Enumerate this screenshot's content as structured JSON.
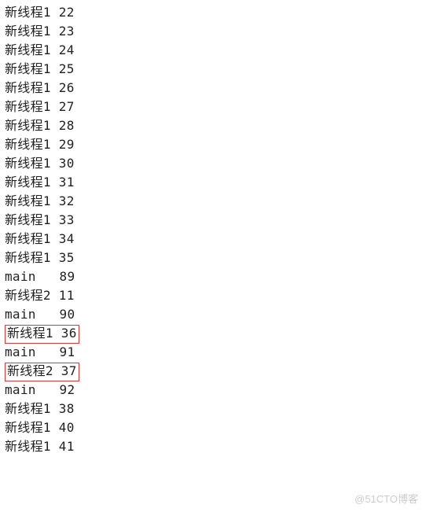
{
  "watermark": "@51CTO博客",
  "lines": [
    {
      "label": "新线程1",
      "value": "22",
      "highlight": false,
      "wide": false
    },
    {
      "label": "新线程1",
      "value": "23",
      "highlight": false,
      "wide": false
    },
    {
      "label": "新线程1",
      "value": "24",
      "highlight": false,
      "wide": false
    },
    {
      "label": "新线程1",
      "value": "25",
      "highlight": false,
      "wide": false
    },
    {
      "label": "新线程1",
      "value": "26",
      "highlight": false,
      "wide": false
    },
    {
      "label": "新线程1",
      "value": "27",
      "highlight": false,
      "wide": false
    },
    {
      "label": "新线程1",
      "value": "28",
      "highlight": false,
      "wide": false
    },
    {
      "label": "新线程1",
      "value": "29",
      "highlight": false,
      "wide": false
    },
    {
      "label": "新线程1",
      "value": "30",
      "highlight": false,
      "wide": false
    },
    {
      "label": "新线程1",
      "value": "31",
      "highlight": false,
      "wide": false
    },
    {
      "label": "新线程1",
      "value": "32",
      "highlight": false,
      "wide": false
    },
    {
      "label": "新线程1",
      "value": "33",
      "highlight": false,
      "wide": false
    },
    {
      "label": "新线程1",
      "value": "34",
      "highlight": false,
      "wide": false
    },
    {
      "label": "新线程1",
      "value": "35",
      "highlight": false,
      "wide": false
    },
    {
      "label": "main",
      "value": "89",
      "highlight": false,
      "wide": true
    },
    {
      "label": "新线程2",
      "value": "11",
      "highlight": false,
      "wide": false
    },
    {
      "label": "main",
      "value": "90",
      "highlight": false,
      "wide": true
    },
    {
      "label": "新线程1",
      "value": "36",
      "highlight": true,
      "wide": false
    },
    {
      "label": "main",
      "value": "91",
      "highlight": false,
      "wide": true
    },
    {
      "label": "新线程2",
      "value": "37",
      "highlight": true,
      "wide": false
    },
    {
      "label": "main",
      "value": "92",
      "highlight": false,
      "wide": true
    },
    {
      "label": "新线程1",
      "value": "38",
      "highlight": false,
      "wide": false
    },
    {
      "label": "新线程1",
      "value": "40",
      "highlight": false,
      "wide": false
    },
    {
      "label": "新线程1",
      "value": "41",
      "highlight": false,
      "wide": false
    }
  ]
}
